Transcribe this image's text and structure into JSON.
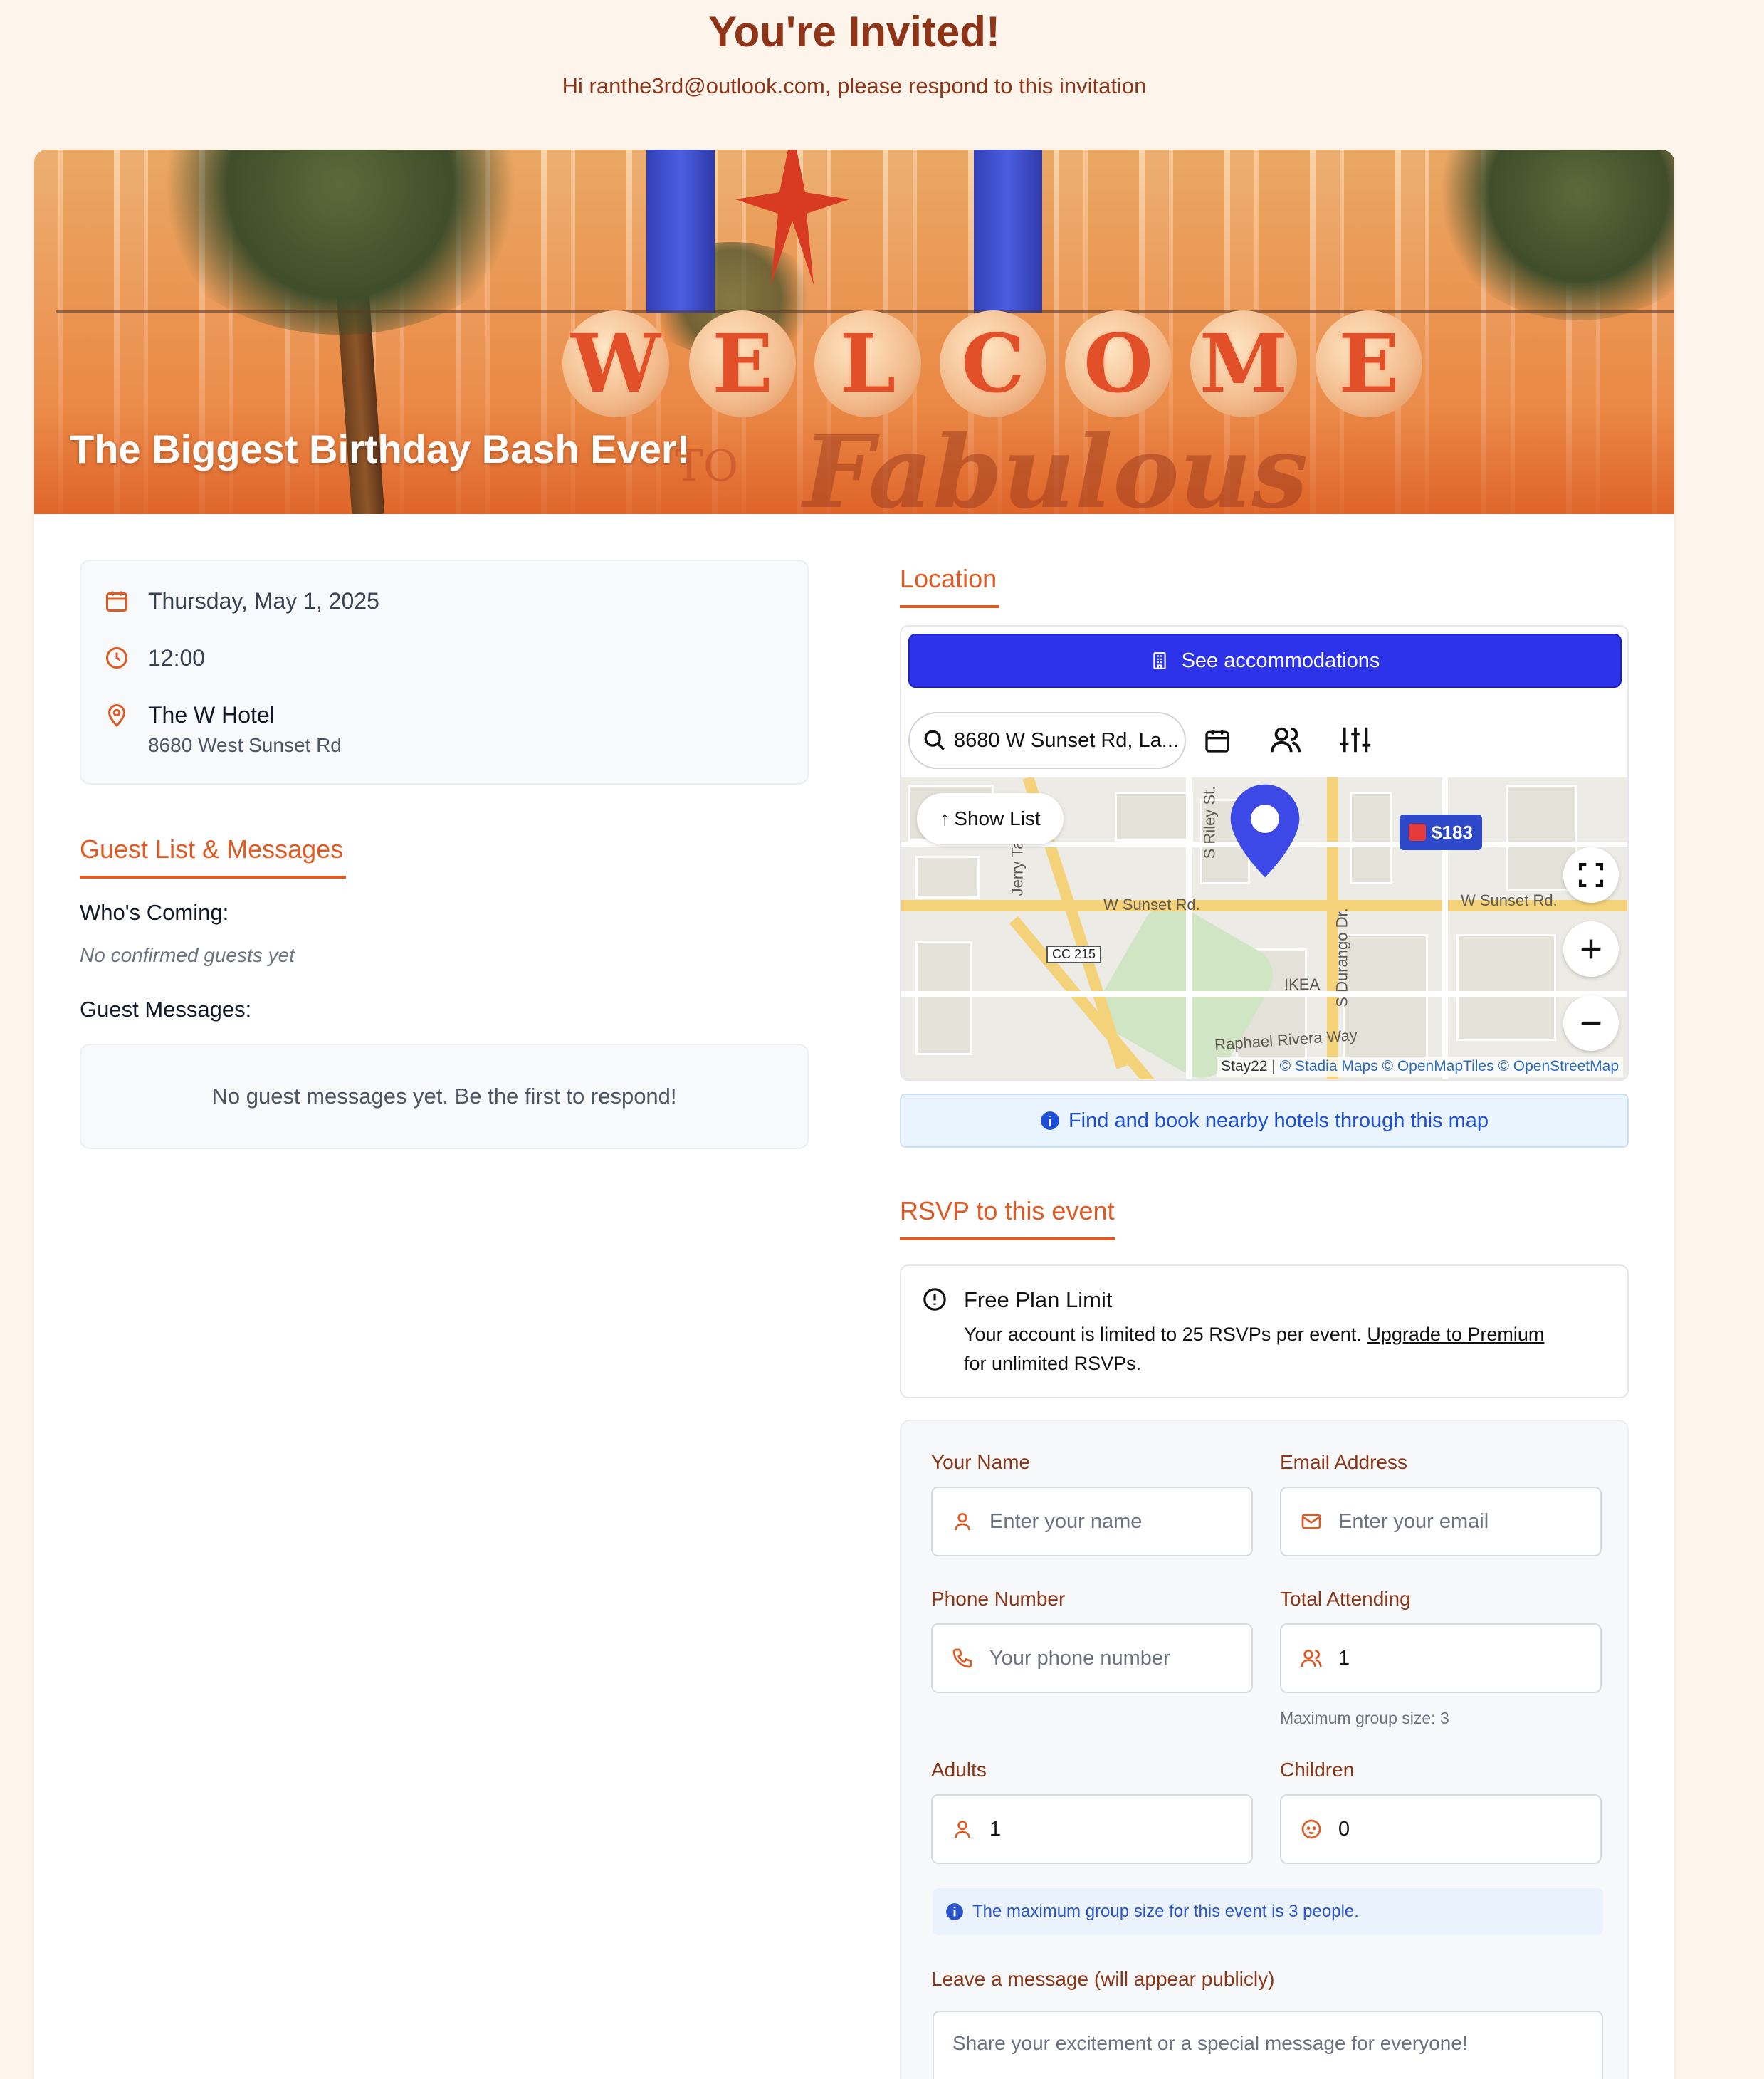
{
  "header": {
    "title": "You're Invited!",
    "subtitle": "Hi ranthe3rd@outlook.com, please respond to this invitation"
  },
  "hero": {
    "event_title": "The Biggest Birthday Bash Ever!",
    "sign_letters": "WELCOME",
    "sign_script": "Fabulous",
    "sign_small": "TO"
  },
  "details": {
    "date": "Thursday, May 1, 2025",
    "time": "12:00",
    "venue": "The W Hotel",
    "address": "8680 West Sunset Rd",
    "icons": [
      "calendar-icon",
      "clock-icon",
      "map-pin-icon"
    ]
  },
  "guests": {
    "heading": "Guest List & Messages",
    "whos_coming_label": "Who's Coming:",
    "no_guests": "No confirmed guests yet",
    "messages_label": "Guest Messages:",
    "no_messages": "No guest messages yet. Be the first to respond!"
  },
  "location": {
    "heading": "Location",
    "accommodations_button": "See accommodations",
    "search_value": "8680 W Sunset Rd, La...",
    "show_list": "Show List",
    "price": "$183",
    "labels": {
      "sunset1": "W Sunset Rd.",
      "sunset2": "W Sunset Rd.",
      "riley": "S Riley St.",
      "durango": "S Durango Dr.",
      "jerry": "Jerry Tarka...",
      "raphael": "Raphael Rivera Way",
      "ikea": "IKEA",
      "cc215": "CC 215"
    },
    "attribution_prefix": "Stay22 | ",
    "attribution_links": "© Stadia Maps © OpenMapTiles © OpenStreetMap",
    "hotel_note": "Find and book nearby hotels through this map"
  },
  "rsvp": {
    "heading": "RSVP to this event",
    "limit_title": "Free Plan Limit",
    "limit_text_before": "Your account is limited to 25 RSVPs per event. ",
    "limit_link": "Upgrade to Premium",
    "limit_text_after": "for unlimited RSVPs.",
    "fields": {
      "name_label": "Your Name",
      "name_placeholder": "Enter your name",
      "email_label": "Email Address",
      "email_placeholder": "Enter your email",
      "phone_label": "Phone Number",
      "phone_placeholder": "Your phone number",
      "total_label": "Total Attending",
      "total_value": "1",
      "total_hint": "Maximum group size: 3",
      "adults_label": "Adults",
      "adults_value": "1",
      "children_label": "Children",
      "children_value": "0"
    },
    "max_note": "The maximum group size for this event is 3 people.",
    "message_label": "Leave a message (will appear publicly)",
    "message_placeholder": "Share your excitement or a special message for everyone!"
  },
  "colors": {
    "accent": "#dd5b24",
    "heading": "#8f3417",
    "primary_button": "#2c33e8",
    "background": "#fdf5ec"
  }
}
